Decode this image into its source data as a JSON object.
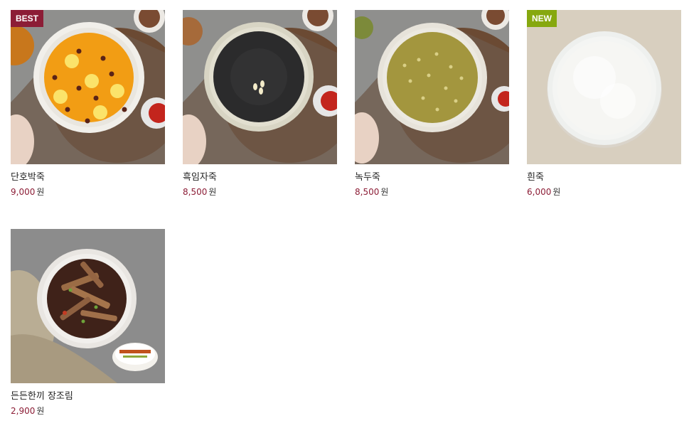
{
  "colors": {
    "price": "#8c1d36",
    "best_badge": "#8c1d36",
    "new_badge": "#86a80f"
  },
  "products": [
    {
      "name": "단호박죽",
      "price": "9,000",
      "currency": "원",
      "badge": "BEST",
      "image": "pumpkin-porridge-image"
    },
    {
      "name": "흑임자죽",
      "price": "8,500",
      "currency": "원",
      "badge": "",
      "image": "black-sesame-porridge-image"
    },
    {
      "name": "녹두죽",
      "price": "8,500",
      "currency": "원",
      "badge": "",
      "image": "mung-bean-porridge-image"
    },
    {
      "name": "흰죽",
      "price": "6,000",
      "currency": "원",
      "badge": "NEW",
      "image": "white-rice-porridge-image"
    },
    {
      "name": "든든한끼 장조림",
      "price": "2,900",
      "currency": "원",
      "badge": "",
      "image": "braised-beef-jangjorim-image"
    }
  ]
}
